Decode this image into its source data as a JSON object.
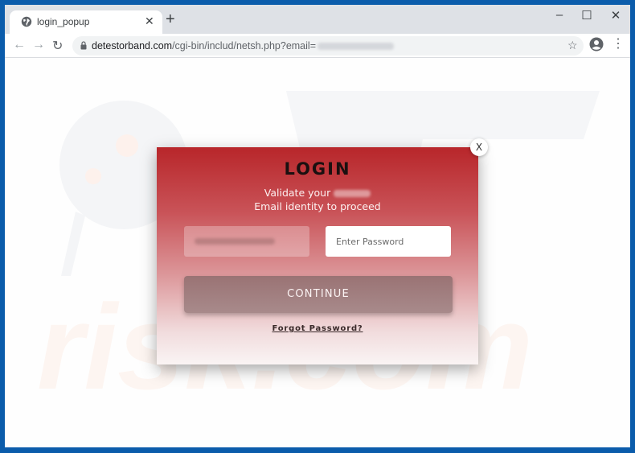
{
  "browser": {
    "tab": {
      "title": "login_popup",
      "icon": "globe-icon",
      "close_label": "✕"
    },
    "new_tab_label": "+",
    "window_controls": {
      "minimize": "–",
      "maximize": "☐",
      "close": "✕"
    },
    "nav": {
      "back": "←",
      "forward": "→",
      "reload": "↻"
    },
    "address": {
      "host": "detestorband.com",
      "path": "/cgi-bin/includ/netsh.php?email="
    },
    "bookmark_label": "☆",
    "menu_label": "⋮"
  },
  "popup": {
    "title": "LOGIN",
    "subtitle_line1": "Validate your",
    "subtitle_line2": "Email identity to proceed",
    "password_placeholder": "Enter Password",
    "continue_label": "CONTINUE",
    "forgot_label": "Forgot Password?",
    "close_label": "X"
  },
  "colors": {
    "window_border": "#0b5cab",
    "popup_top": "#b8262a",
    "popup_bottom": "#faf4f4"
  }
}
